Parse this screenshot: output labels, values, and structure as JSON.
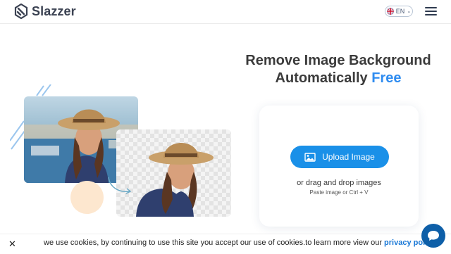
{
  "header": {
    "brand": "Slazzer",
    "language": "EN"
  },
  "hero": {
    "title_line1": "Remove Image Background",
    "title_line2_prefix": "Automatically ",
    "title_line2_accent": "Free"
  },
  "upload": {
    "button_label": "Upload Image",
    "drag_text": "or drag and drop images",
    "paste_text": "Paste image or Ctrl + V"
  },
  "cookie": {
    "text": "we use cookies, by continuing to use this site you accept our use of cookies.to learn more view our ",
    "link_text": "privacy policy.",
    "close_symbol": "✕"
  },
  "icons": {
    "logo": "slazzer-logo-icon",
    "flag": "uk-flag-icon",
    "chevron": "chevron-down-icon",
    "menu": "hamburger-menu-icon",
    "upload": "image-icon",
    "chat": "chat-bubble-icon"
  },
  "colors": {
    "accent": "#1a90e8",
    "accent_text": "#2f8cf0",
    "chat": "#0e5fa8",
    "brand_text": "#3b4252"
  }
}
